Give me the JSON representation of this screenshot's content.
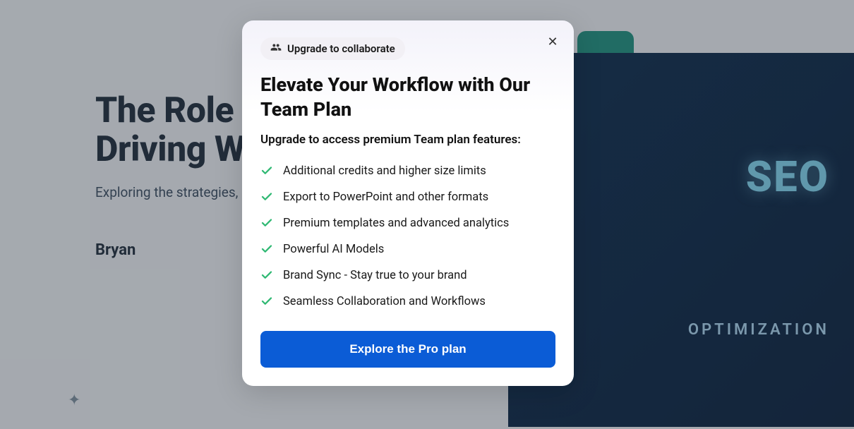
{
  "hero": {
    "title": "The Role of SEO in Driving Website Traffic",
    "subtitle": "Exploring the strategies, benefits, and online visibility",
    "author": "Bryan"
  },
  "seo_panel": {
    "label_main": "SEO",
    "label_sub": "OPTIMIZATION"
  },
  "modal": {
    "badge": "Upgrade to collaborate",
    "title": "Elevate Your Workflow with Our Team Plan",
    "subtitle": "Upgrade to access premium Team plan features:",
    "features": [
      "Additional credits and higher size limits",
      "Export to PowerPoint and other formats",
      "Premium templates and advanced analytics",
      "Powerful AI Models",
      "Brand Sync - Stay true to your brand",
      "Seamless Collaboration and Workflows"
    ],
    "cta": "Explore the Pro plan"
  }
}
